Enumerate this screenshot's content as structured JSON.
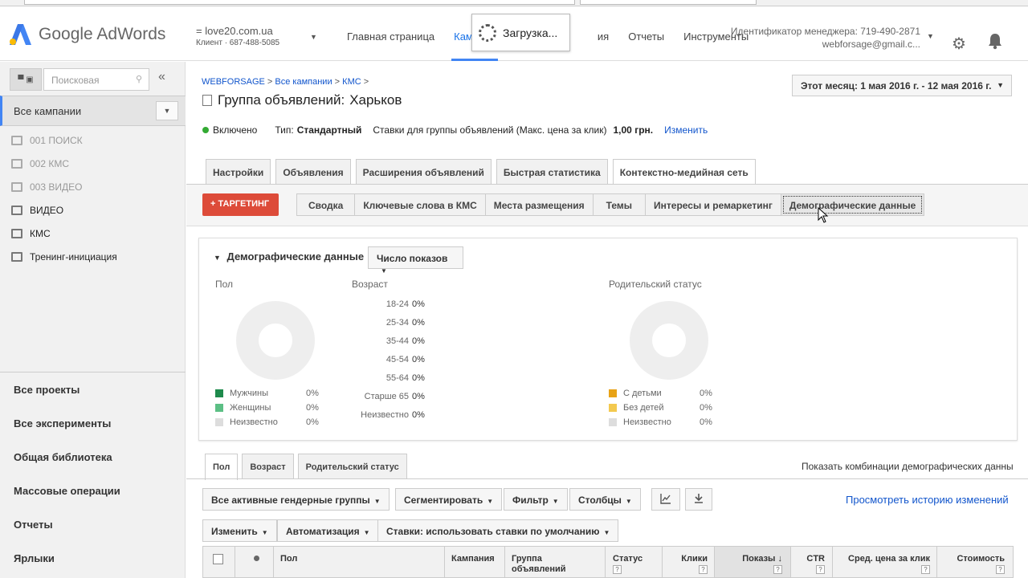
{
  "header": {
    "logo_text": "Google AdWords",
    "account_name": "= love20.com.ua",
    "account_client": "Клиент · 687-488-5085",
    "nav": [
      "Главная страница",
      "Камп",
      "ия",
      "Отчеты",
      "Инструменты"
    ],
    "loading_text": "Загрузка...",
    "manager_id": "Идентификатор менеджера: 719-490-2871",
    "manager_email": "webforsage@gmail.c..."
  },
  "sidebar": {
    "search_placeholder": "Поисковая",
    "all_campaigns": "Все кампании",
    "campaigns": [
      {
        "label": "001 ПОИСК",
        "icon": "search-icon",
        "paused": true
      },
      {
        "label": "002 КМС",
        "icon": "display-icon",
        "paused": true
      },
      {
        "label": "003 ВИДЕО",
        "icon": "video-icon",
        "paused": true
      },
      {
        "label": "ВИДЕО",
        "icon": "video-icon",
        "paused": false
      },
      {
        "label": "КМС",
        "icon": "display-icon",
        "paused": false
      },
      {
        "label": "Тренинг-инициация",
        "icon": "search-icon",
        "paused": false
      }
    ],
    "bottom_links": [
      "Все проекты",
      "Все эксперименты",
      "Общая библиотека",
      "Массовые операции",
      "Отчеты",
      "Ярлыки"
    ]
  },
  "breadcrumb": {
    "items": [
      "WEBFORSAGE",
      "Все кампании",
      "КМС"
    ],
    "sep": ">"
  },
  "page_title": {
    "prefix": "Группа объявлений:",
    "name": "Харьков"
  },
  "date_range": "Этот месяц: 1 мая 2016 г. - 12 мая 2016 г.",
  "status": {
    "state": "Включено",
    "type_label": "Тип:",
    "type_value": "Стандартный",
    "bid_label": "Ставки для группы объявлений (Макс. цена за клик)",
    "bid_value": "1,00 грн.",
    "edit_link": "Изменить"
  },
  "tabs": [
    "Настройки",
    "Объявления",
    "Расширения объявлений",
    "Быстрая статистика",
    "Контекстно-медийная сеть"
  ],
  "targeting_button": "+ ТАРГЕТИНГ",
  "subtabs": [
    "Сводка",
    "Ключевые слова в КМС",
    "Места размещения",
    "Темы",
    "Интересы и ремаркетинг",
    "Демографические данные"
  ],
  "demographics": {
    "title": "Демографические данные",
    "metric_button": "Число показов",
    "gender": {
      "label": "Пол",
      "items": [
        {
          "name": "Мужчины",
          "pct": "0%",
          "color": "#1e8a4c"
        },
        {
          "name": "Женщины",
          "pct": "0%",
          "color": "#5cbf85"
        },
        {
          "name": "Неизвестно",
          "pct": "0%",
          "color": "#dddddd"
        }
      ]
    },
    "age": {
      "label": "Возраст",
      "items": [
        {
          "name": "18-24",
          "pct": "0%"
        },
        {
          "name": "25-34",
          "pct": "0%"
        },
        {
          "name": "35-44",
          "pct": "0%"
        },
        {
          "name": "45-54",
          "pct": "0%"
        },
        {
          "name": "55-64",
          "pct": "0%"
        },
        {
          "name": "Старше 65",
          "pct": "0%"
        },
        {
          "name": "Неизвестно",
          "pct": "0%"
        }
      ]
    },
    "parental": {
      "label": "Родительский статус",
      "items": [
        {
          "name": "С детьми",
          "pct": "0%",
          "color": "#e8a317"
        },
        {
          "name": "Без детей",
          "pct": "0%",
          "color": "#f3c94f"
        },
        {
          "name": "Неизвестно",
          "pct": "0%",
          "color": "#dddddd"
        }
      ]
    }
  },
  "bottom_tabs": [
    "Пол",
    "Возраст",
    "Родительский статус"
  ],
  "combos_text": "Показать комбинации демографических данны",
  "toolbar": {
    "filter_groups": "Все активные гендерные группы",
    "segment": "Сегментировать",
    "filter": "Фильтр",
    "columns": "Столбцы",
    "history": "Просмотреть историю изменений",
    "edit": "Изменить",
    "automation": "Автоматизация",
    "bids": "Ставки: использовать ставки по умолчанию"
  },
  "table_headers": {
    "gender": "Пол",
    "campaign": "Кампания",
    "adgroup_1": "Группа",
    "adgroup_2": "объявлений",
    "status": "Статус",
    "clicks": "Клики",
    "impressions": "Показы",
    "ctr": "CTR",
    "avg_cpc": "Сред. цена за клик",
    "cost": "Стоимость"
  }
}
